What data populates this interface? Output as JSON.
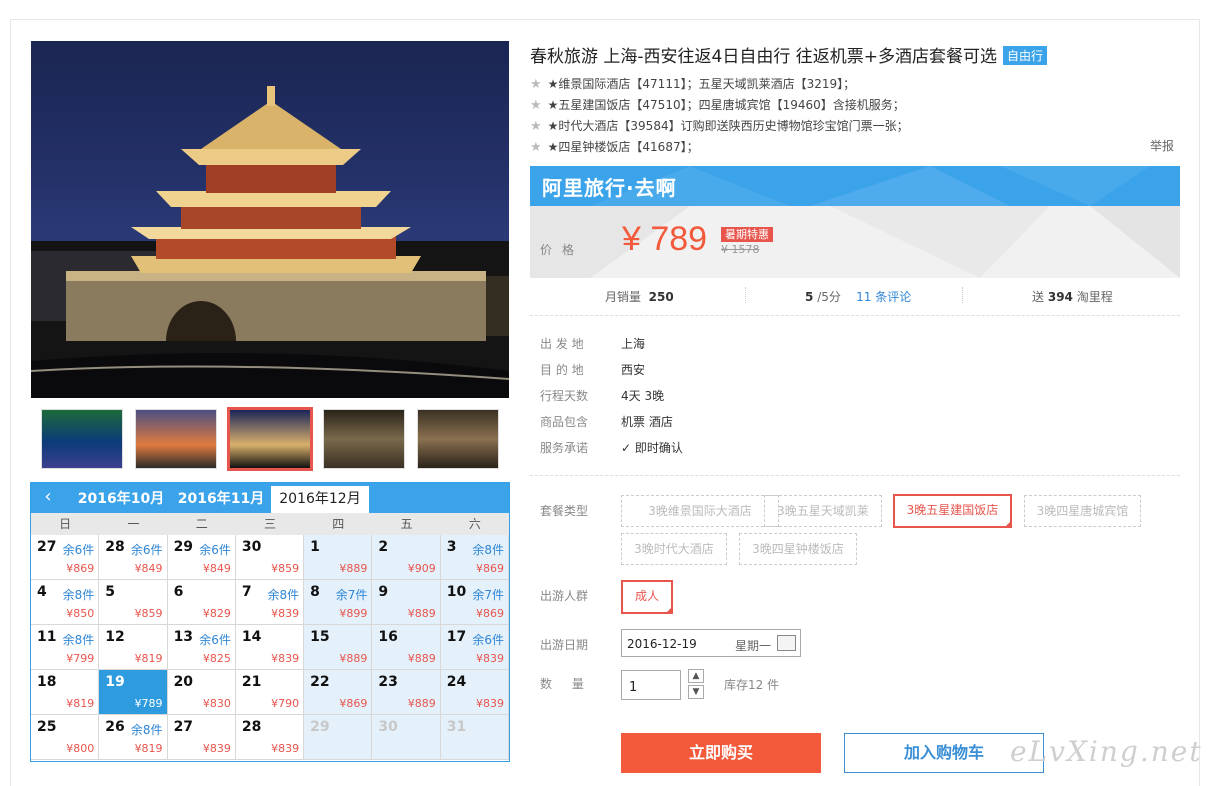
{
  "product": {
    "title": "春秋旅游 上海-西安往返4日自由行 往返机票+多酒店套餐可选",
    "tag": "自由行",
    "hotel_lines": [
      "★维景国际酒店【47111】；五星天域凯莱酒店【3219】；",
      "★五星建国饭店【47510】；四星唐城宾馆【19460】含接机服务；",
      "★时代大酒店【39584】订购即送陕西历史博物馆珍宝馆门票一张；",
      "★四星钟楼饭店【41687】；"
    ],
    "report": "举报"
  },
  "banner": {
    "brand": "阿里旅行·去啊",
    "color": "#3aa3ea"
  },
  "price": {
    "label": "价格",
    "current": "¥ 789",
    "promo": "暑期特惠",
    "original": "¥ 1578"
  },
  "stats": {
    "sales_label": "月销量",
    "sales": "250",
    "score": "5",
    "score_suffix": "/5分",
    "reviews": "11 条评论",
    "points_pre": "送",
    "points": "394",
    "points_suffix": "淘里程"
  },
  "info": [
    {
      "k": "出 发 地",
      "v": "上海"
    },
    {
      "k": "目 的 地",
      "v": "西安"
    },
    {
      "k": "行程天数",
      "v": "4天 3晚"
    },
    {
      "k": "商品包含",
      "v": "机票 酒店"
    },
    {
      "k": "服务承诺",
      "v": "即时确认"
    }
  ],
  "options": {
    "package_label": "套餐类型",
    "packages": [
      "3晚维景国际大酒店",
      "3晚五星天域凯莱",
      "3晚五星建国饭店",
      "3晚四星唐城宾馆",
      "3晚时代大酒店",
      "3晚四星钟楼饭店"
    ],
    "package_selected": "3晚五星建国饭店",
    "crowd_label": "出游人群",
    "crowd": "成人",
    "date_label": "出游日期",
    "date": "2016-12-19",
    "weekday": "星期一",
    "qty_label": "数 量",
    "qty": "1",
    "stock": "库存12 件"
  },
  "buttons": {
    "buy": "立即购买",
    "cart": "加入购物车"
  },
  "watermark": "eLvXing.net",
  "calendar": {
    "tabs": [
      "2016年10月",
      "2016年11月",
      "2016年12月"
    ],
    "active_tab": "2016年12月",
    "weekdays": [
      "日",
      "一",
      "二",
      "三",
      "四",
      "五",
      "六"
    ],
    "cells": [
      {
        "d": "27",
        "s": "余6件",
        "p": "¥869"
      },
      {
        "d": "28",
        "s": "余6件",
        "p": "¥849"
      },
      {
        "d": "29",
        "s": "余6件",
        "p": "¥849"
      },
      {
        "d": "30",
        "s": "",
        "p": "¥859"
      },
      {
        "d": "1",
        "s": "",
        "p": "¥889"
      },
      {
        "d": "2",
        "s": "",
        "p": "¥909"
      },
      {
        "d": "3",
        "s": "余8件",
        "p": "¥869"
      },
      {
        "d": "4",
        "s": "余8件",
        "p": "¥850"
      },
      {
        "d": "5",
        "s": "",
        "p": "¥859"
      },
      {
        "d": "6",
        "s": "",
        "p": "¥829"
      },
      {
        "d": "7",
        "s": "余8件",
        "p": "¥839"
      },
      {
        "d": "8",
        "s": "余7件",
        "p": "¥899"
      },
      {
        "d": "9",
        "s": "",
        "p": "¥889"
      },
      {
        "d": "10",
        "s": "余7件",
        "p": "¥869"
      },
      {
        "d": "11",
        "s": "余8件",
        "p": "¥799"
      },
      {
        "d": "12",
        "s": "",
        "p": "¥819"
      },
      {
        "d": "13",
        "s": "余6件",
        "p": "¥825"
      },
      {
        "d": "14",
        "s": "",
        "p": "¥839"
      },
      {
        "d": "15",
        "s": "",
        "p": "¥889"
      },
      {
        "d": "16",
        "s": "",
        "p": "¥889"
      },
      {
        "d": "17",
        "s": "余6件",
        "p": "¥839"
      },
      {
        "d": "18",
        "s": "",
        "p": "¥819"
      },
      {
        "d": "19",
        "s": "",
        "p": "¥789"
      },
      {
        "d": "20",
        "s": "",
        "p": "¥830"
      },
      {
        "d": "21",
        "s": "",
        "p": "¥790"
      },
      {
        "d": "22",
        "s": "",
        "p": "¥869"
      },
      {
        "d": "23",
        "s": "",
        "p": "¥889"
      },
      {
        "d": "24",
        "s": "",
        "p": "¥839"
      },
      {
        "d": "25",
        "s": "",
        "p": "¥800"
      },
      {
        "d": "26",
        "s": "余8件",
        "p": "¥819"
      },
      {
        "d": "27",
        "s": "",
        "p": "¥839"
      },
      {
        "d": "28",
        "s": "",
        "p": "¥839"
      },
      {
        "d": "29",
        "s": "",
        "p": ""
      },
      {
        "d": "30",
        "s": "",
        "p": ""
      },
      {
        "d": "31",
        "s": "",
        "p": ""
      }
    ],
    "selected_day": "19"
  }
}
